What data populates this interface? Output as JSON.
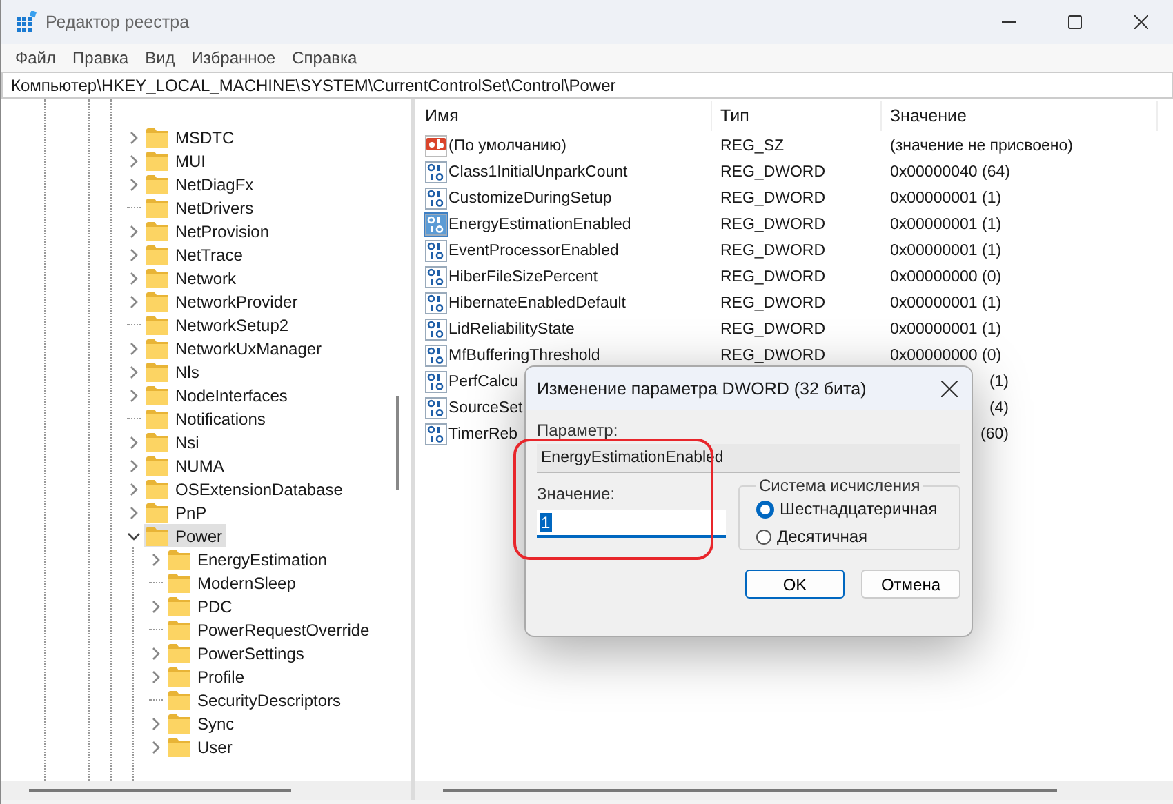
{
  "window": {
    "title": "Редактор реестра"
  },
  "menu": [
    "Файл",
    "Правка",
    "Вид",
    "Избранное",
    "Справка"
  ],
  "address": "Компьютер\\HKEY_LOCAL_MACHINE\\SYSTEM\\CurrentControlSet\\Control\\Power",
  "tree": [
    {
      "name": "MSDTC",
      "has_children": true,
      "expanded": false,
      "selected": false
    },
    {
      "name": "MUI",
      "has_children": true,
      "expanded": false,
      "selected": false
    },
    {
      "name": "NetDiagFx",
      "has_children": true,
      "expanded": false,
      "selected": false
    },
    {
      "name": "NetDrivers",
      "has_children": false,
      "selected": false
    },
    {
      "name": "NetProvision",
      "has_children": true,
      "expanded": false,
      "selected": false
    },
    {
      "name": "NetTrace",
      "has_children": true,
      "expanded": false,
      "selected": false
    },
    {
      "name": "Network",
      "has_children": true,
      "expanded": false,
      "selected": false
    },
    {
      "name": "NetworkProvider",
      "has_children": true,
      "expanded": false,
      "selected": false
    },
    {
      "name": "NetworkSetup2",
      "has_children": false,
      "selected": false
    },
    {
      "name": "NetworkUxManager",
      "has_children": true,
      "expanded": false,
      "selected": false
    },
    {
      "name": "Nls",
      "has_children": true,
      "expanded": false,
      "selected": false
    },
    {
      "name": "NodeInterfaces",
      "has_children": true,
      "expanded": false,
      "selected": false
    },
    {
      "name": "Notifications",
      "has_children": false,
      "selected": false
    },
    {
      "name": "Nsi",
      "has_children": true,
      "expanded": false,
      "selected": false
    },
    {
      "name": "NUMA",
      "has_children": true,
      "expanded": false,
      "selected": false
    },
    {
      "name": "OSExtensionDatabase",
      "has_children": true,
      "expanded": false,
      "selected": false
    },
    {
      "name": "PnP",
      "has_children": true,
      "expanded": false,
      "selected": false
    },
    {
      "name": "Power",
      "has_children": true,
      "expanded": true,
      "selected": true,
      "children": [
        {
          "name": "EnergyEstimation",
          "has_children": true,
          "expanded": false,
          "selected": false
        },
        {
          "name": "ModernSleep",
          "has_children": false,
          "selected": false
        },
        {
          "name": "PDC",
          "has_children": true,
          "expanded": false,
          "selected": false
        },
        {
          "name": "PowerRequestOverride",
          "has_children": false,
          "selected": false
        },
        {
          "name": "PowerSettings",
          "has_children": true,
          "expanded": false,
          "selected": false
        },
        {
          "name": "Profile",
          "has_children": true,
          "expanded": false,
          "selected": false
        },
        {
          "name": "SecurityDescriptors",
          "has_children": false,
          "selected": false
        },
        {
          "name": "Sync",
          "has_children": true,
          "expanded": false,
          "selected": false
        },
        {
          "name": "User",
          "has_children": true,
          "expanded": false,
          "selected": false
        }
      ]
    }
  ],
  "list": {
    "columns": [
      "Имя",
      "Тип",
      "Значение"
    ],
    "rows": [
      {
        "kind": "string",
        "name": "(По умолчанию)",
        "type": "REG_SZ",
        "value": "(значение не присвоено)",
        "selected": false
      },
      {
        "kind": "dword",
        "name": "Class1InitialUnparkCount",
        "type": "REG_DWORD",
        "value": "0x00000040 (64)",
        "selected": false
      },
      {
        "kind": "dword",
        "name": "CustomizeDuringSetup",
        "type": "REG_DWORD",
        "value": "0x00000001 (1)",
        "selected": false
      },
      {
        "kind": "dword",
        "name": "EnergyEstimationEnabled",
        "type": "REG_DWORD",
        "value": "0x00000001 (1)",
        "selected": true
      },
      {
        "kind": "dword",
        "name": "EventProcessorEnabled",
        "type": "REG_DWORD",
        "value": "0x00000001 (1)",
        "selected": false
      },
      {
        "kind": "dword",
        "name": "HiberFileSizePercent",
        "type": "REG_DWORD",
        "value": "0x00000000 (0)",
        "selected": false
      },
      {
        "kind": "dword",
        "name": "HibernateEnabledDefault",
        "type": "REG_DWORD",
        "value": "0x00000001 (1)",
        "selected": false
      },
      {
        "kind": "dword",
        "name": "LidReliabilityState",
        "type": "REG_DWORD",
        "value": "0x00000001 (1)",
        "selected": false
      },
      {
        "kind": "dword",
        "name": "MfBufferingThreshold",
        "type": "REG_DWORD",
        "value": "0x00000000 (0)",
        "selected": false
      },
      {
        "kind": "dword",
        "name": "PerfCalcu",
        "value": "(1)",
        "selected": false
      },
      {
        "kind": "dword",
        "name": "SourceSet",
        "value": "(4)",
        "selected": false
      },
      {
        "kind": "dword",
        "name": "TimerReb",
        "value": "(60)",
        "selected": false
      }
    ]
  },
  "dialog": {
    "title": "Изменение параметра DWORD (32 бита)",
    "param_label": "Параметр:",
    "param_value": "EnergyEstimationEnabled",
    "value_label": "Значение:",
    "value": "1",
    "radix_title": "Система исчисления",
    "radix": [
      {
        "label": "Шестнадцатеричная",
        "selected": true
      },
      {
        "label": "Десятичная",
        "selected": false
      }
    ],
    "buttons": [
      {
        "label": "OK",
        "default": true
      },
      {
        "label": "Отмена",
        "default": false
      }
    ]
  }
}
